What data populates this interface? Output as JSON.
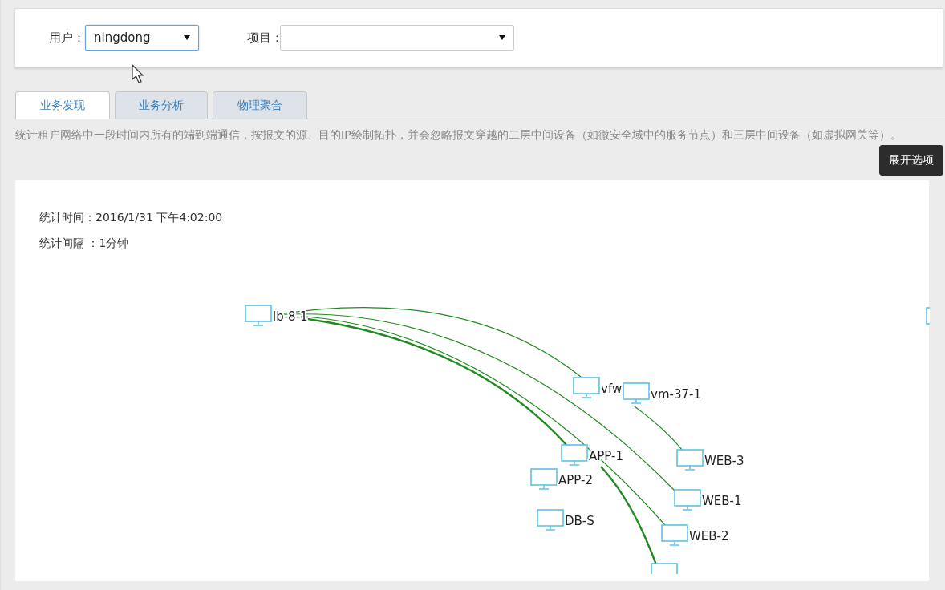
{
  "filters": [
    {
      "label": "用户：",
      "value": "ningdong",
      "focused": true
    },
    {
      "label": "项目：",
      "focused": false
    }
  ],
  "tabs": [
    {
      "label": "业务发现",
      "selected": true
    },
    {
      "label": "业务分析",
      "selected": false
    },
    {
      "label": "物理聚合",
      "selected": false
    }
  ],
  "description": "统计租户网络中一段时间内所有的端到端通信，按报文的源、目的IP绘制拓扑，并会忽略报文穿越的二层中间设备（如微安全域中的服务节点）和三层中间设备（如虚拟网关等）。",
  "expand_button": "展开选项",
  "stats": [
    "统计时间：2016/1/31 下午4:02:00",
    "统计间隔 ：1分钟"
  ],
  "topology": {
    "nodes": [
      {
        "label": "lb-8-1"
      },
      {
        "label": "vfw"
      },
      {
        "label": "vm-37-1"
      },
      {
        "label": "APP-1"
      },
      {
        "label": "APP-2"
      },
      {
        "label": "DB-S"
      },
      {
        "label": "WEB-3"
      },
      {
        "label": "WEB-1"
      },
      {
        "label": "WEB-2"
      }
    ]
  }
}
